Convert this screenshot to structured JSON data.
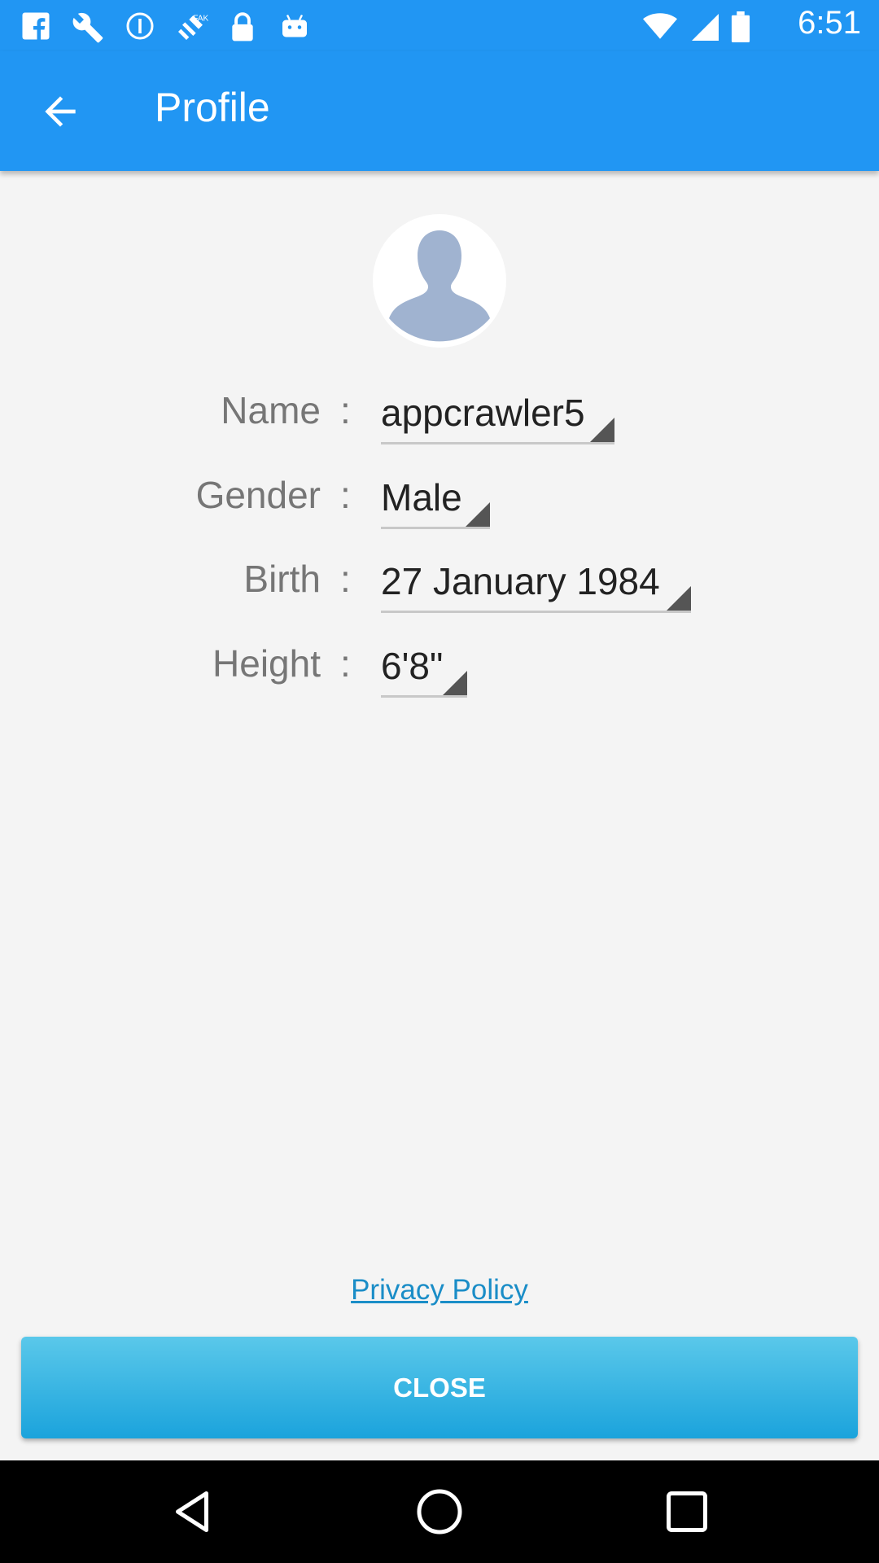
{
  "status_bar": {
    "time": "6:51",
    "icons": [
      "facebook-icon",
      "wrench-icon",
      "info-icon",
      "satellite-icon",
      "lock-icon",
      "android-icon",
      "wifi-icon",
      "signal-icon",
      "battery-icon"
    ]
  },
  "app_bar": {
    "title": "Profile",
    "back_icon": "arrow-back-icon"
  },
  "profile": {
    "avatar_icon": "user-silhouette-icon",
    "fields": [
      {
        "label": "Name",
        "separator": ":",
        "value": "appcrawler5"
      },
      {
        "label": "Gender",
        "separator": ":",
        "value": "Male"
      },
      {
        "label": "Birth",
        "separator": ":",
        "value": "27 January 1984"
      },
      {
        "label": "Height",
        "separator": ":",
        "value": "6'8\""
      }
    ]
  },
  "privacy_link": "Privacy Policy",
  "close_button": "CLOSE",
  "nav_bar": {
    "icons": [
      "back-triangle-icon",
      "home-circle-icon",
      "recents-square-icon"
    ]
  },
  "colors": {
    "primary": "#2196F3",
    "link": "#1a8dc7",
    "button": "#1ba3dc"
  }
}
